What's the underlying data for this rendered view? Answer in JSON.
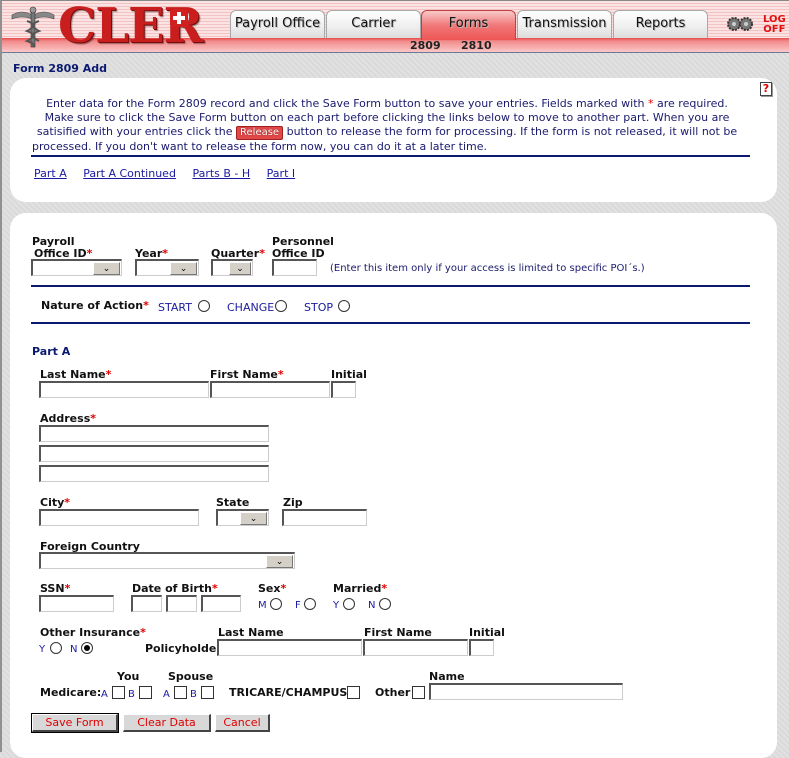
{
  "app": {
    "logo_text": "CLER",
    "tabs": [
      {
        "label": "Payroll Office",
        "active": false
      },
      {
        "label": "Carrier",
        "active": false
      },
      {
        "label": "Forms",
        "active": true
      },
      {
        "label": "Transmission",
        "active": false
      },
      {
        "label": "Reports",
        "active": false
      }
    ],
    "subnav": [
      "2809",
      "2810"
    ],
    "logoff_line1": "LOG",
    "logoff_line2": "OFF"
  },
  "page": {
    "title": "Form 2809 Add",
    "help_label": "?",
    "intro": {
      "line1_a": "Enter data for the Form 2809 record and click the Save Form button to save your entries.  Fields marked with ",
      "required_mark": "*",
      "line1_b": " are required.",
      "line2": "Make sure to click the Save Form button on each part before clicking the links below to move to another part.  When you are",
      "line3_a": "satisified with your entries click the ",
      "release_label": "Release",
      "line3_b": " button to release the form for processing.  If the form is not released, it will not be",
      "line4": "processed.  If you don't want to release the form now, you can do it at a later time."
    },
    "part_links": [
      "Part A",
      "Part A Continued",
      "Parts B - H",
      "Part I"
    ]
  },
  "form": {
    "payroll_office_label_1": "Payroll",
    "payroll_office_label_2": "Office ID",
    "payroll_office_value": "",
    "year_label": "Year",
    "year_value": "",
    "quarter_label": "Quarter",
    "quarter_value": "",
    "personnel_label_1": "Personnel",
    "personnel_label_2": "Office ID",
    "personnel_value": "",
    "personnel_note": "(Enter this item only if your access is limited to specific POI´s.)",
    "nature_label": "Nature of Action",
    "nature_options": [
      {
        "label": "START",
        "checked": false
      },
      {
        "label": "CHANGE",
        "checked": false
      },
      {
        "label": "STOP",
        "checked": false
      }
    ],
    "part_a_heading": "Part A",
    "last_name_label": "Last Name",
    "first_name_label": "First Name",
    "initial_label": "Initial",
    "address_label": "Address",
    "city_label": "City",
    "state_label": "State",
    "zip_label": "Zip",
    "foreign_country_label": "Foreign Country",
    "ssn_label": "SSN",
    "dob_label": "Date of Birth",
    "sex_label": "Sex",
    "sex_options": [
      {
        "label": "M",
        "checked": false
      },
      {
        "label": "F",
        "checked": false
      }
    ],
    "married_label": "Married",
    "married_options": [
      {
        "label": "Y",
        "checked": false
      },
      {
        "label": "N",
        "checked": false
      }
    ],
    "other_insurance_label": "Other Insurance",
    "other_insurance_options": [
      {
        "label": "Y",
        "checked": false
      },
      {
        "label": "N",
        "checked": true
      }
    ],
    "policyholder_label": "Policyholder",
    "ph_last_name_label": "Last Name",
    "ph_first_name_label": "First Name",
    "ph_initial_label": "Initial",
    "medicare_label": "Medicare:",
    "you_label": "You",
    "spouse_label": "Spouse",
    "medicare_a": "A",
    "medicare_b": "B",
    "tricare_label": "TRICARE/CHAMPUS",
    "other_label": "Other",
    "name_label": "Name",
    "required_mark": "*"
  },
  "buttons": {
    "save": "Save Form",
    "clear": "Clear Data",
    "cancel": "Cancel"
  }
}
